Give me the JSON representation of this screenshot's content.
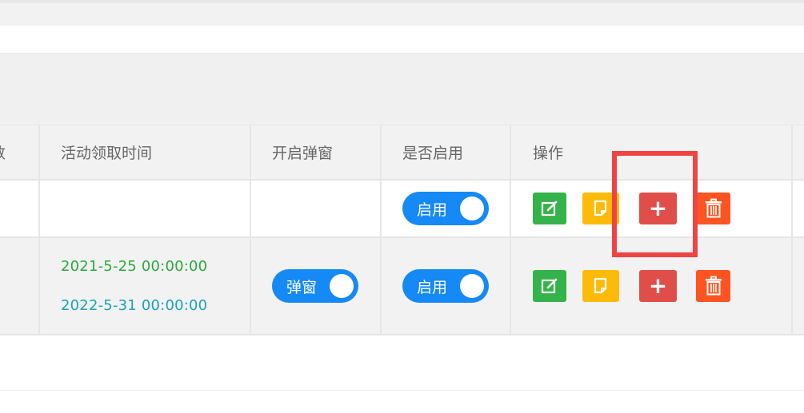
{
  "table": {
    "headers": {
      "count_partial": "数",
      "activity_time": "活动领取时间",
      "popup": "开启弹窗",
      "enabled": "是否启用",
      "actions": "操作"
    },
    "rows": [
      {
        "start_time": "",
        "end_time": "",
        "popup_switch_label": "",
        "enabled_switch_label": "启用"
      },
      {
        "start_time": "2021-5-25 00:00:00",
        "end_time": "2022-5-31 00:00:00",
        "popup_switch_label": "弹窗",
        "enabled_switch_label": "启用"
      }
    ]
  },
  "colors": {
    "switch_blue": "#1589f5",
    "edit_green": "#34b34a",
    "doc_yellow": "#fdba08",
    "add_red": "#e14e4a",
    "delete_orange": "#fe5422",
    "highlight_red": "#f04343",
    "date_start": "#2aaa3c",
    "date_end": "#1aa3b5"
  },
  "icons": {
    "edit": "edit-icon",
    "document": "document-icon",
    "add": "plus-icon",
    "delete": "trash-icon"
  }
}
